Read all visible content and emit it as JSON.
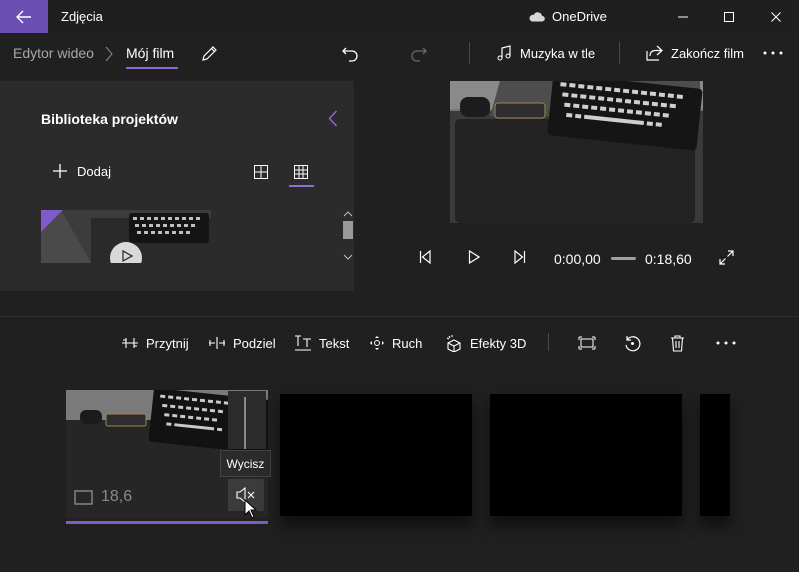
{
  "titlebar": {
    "app_title": "Zdjęcia",
    "cloud_label": "OneDrive",
    "icons": [
      "back-arrow-icon",
      "cloud-icon",
      "minimize-icon",
      "maximize-icon",
      "close-icon"
    ],
    "accent": "#6b4fb2"
  },
  "commandbar": {
    "breadcrumb_parent": "Edytor wideo",
    "breadcrumb_current": "Mój film",
    "music_label": "Muzyka w tle",
    "finish_label": "Zakończ film",
    "icons": [
      "pencil-icon",
      "undo-icon",
      "redo-icon",
      "music-note-icon",
      "share-export-icon",
      "more-icon"
    ]
  },
  "library": {
    "title": "Biblioteka projektów",
    "add_label": "Dodaj",
    "view_selected": "small-grid",
    "icons": [
      "collapse-chevron-icon",
      "plus-icon",
      "large-grid-icon",
      "small-grid-icon",
      "play-icon"
    ]
  },
  "preview": {
    "current_time": "0:00,00",
    "total_time": "0:18,60",
    "icons": [
      "previous-frame-icon",
      "play-icon",
      "next-frame-icon",
      "expand-icon"
    ]
  },
  "timeline_toolbar": {
    "trim": "Przytnij",
    "split": "Podziel",
    "text": "Tekst",
    "motion": "Ruch",
    "effects3d": "Efekty 3D",
    "icons": [
      "trim-icon",
      "split-icon",
      "text-icon",
      "motion-icon",
      "effects-3d-icon",
      "resize-icon",
      "rotate-icon",
      "delete-icon",
      "more-icon"
    ]
  },
  "storyboard": {
    "clip_duration": "18,6",
    "mute_tooltip": "Wycisz",
    "selected_clip": 1,
    "empty_slots": 3,
    "icons": [
      "clip-duration-icon",
      "volume-mute-icon",
      "mouse-cursor-icon"
    ]
  },
  "colors": {
    "selection": "#7f5bc9",
    "background": "#202020",
    "panel": "#2b2b2b"
  }
}
